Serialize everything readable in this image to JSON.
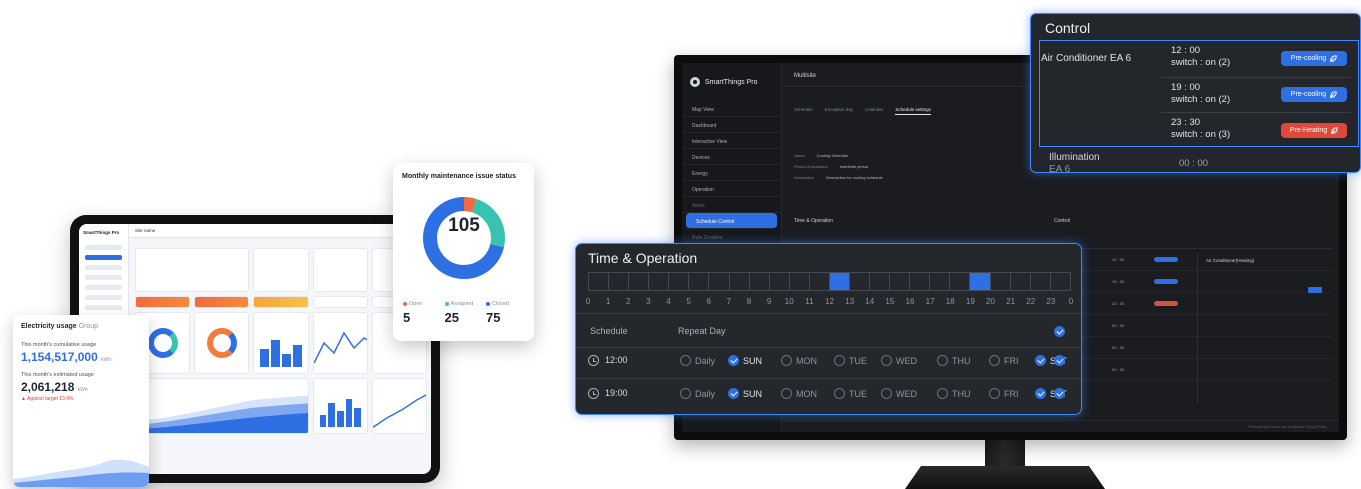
{
  "tablet": {
    "logo": "SmartThings Pro",
    "header": "Site name"
  },
  "maintenance": {
    "title": "Monthly maintenance issue status",
    "total": "105",
    "stats": [
      {
        "label": "Open",
        "value": "5",
        "color": "#f26a3d"
      },
      {
        "label": "Assigned",
        "value": "25",
        "color": "#38c2b1"
      },
      {
        "label": "Closed",
        "value": "75",
        "color": "#2f6fe4"
      }
    ]
  },
  "electricity": {
    "title": "Electricity usage",
    "group": "Group",
    "cumulative_label": "This month's cumulative usage",
    "cumulative_value": "1,154,517,000",
    "cumulative_unit": "kWh",
    "estimated_label": "This month's estimated usage",
    "estimated_value": "2,061,218",
    "estimated_unit": "kWh",
    "target": "▲ Against target 13.4%"
  },
  "monitor": {
    "logo": "SmartThings Pro",
    "topbar": "Multisite",
    "nav": [
      "Map View",
      "Dashboard",
      "Interactive View",
      "Devices",
      "Energy",
      "Operation",
      "Alerts",
      "Schedule Control",
      "Rule Creation"
    ],
    "tabs": [
      "Schedule",
      "Exception day",
      "Calendar",
      "Schedule settings"
    ],
    "form": [
      {
        "k": "Name",
        "v": "Cooling Schedule"
      },
      {
        "k": "Period of operation",
        "v": "Indefinite period"
      },
      {
        "k": "Description",
        "v": "Description for cooling schedule"
      }
    ],
    "section_time": "Time & Operation",
    "section_control": "Control",
    "right_title": "Air Conditioner(Heating)",
    "footer": "Personal Info   Terms and Conditions   Privacy Policy"
  },
  "control": {
    "title": "Control",
    "device": "Air Conditioner EA 6",
    "entries": [
      {
        "time": "12 : 00",
        "switch": "switch : on (2)",
        "action": "Pre-cooling",
        "color": "blue"
      },
      {
        "time": "19 : 00",
        "switch": "switch : on (2)",
        "action": "Pre-cooling",
        "color": "blue"
      },
      {
        "time": "23 : 30",
        "switch": "switch : on (3)",
        "action": "Pre-Heating",
        "color": "red"
      }
    ],
    "illumination": "Illumination",
    "illumination_sub": "EA 6",
    "illumination_time": "00 : 00"
  },
  "time_operation": {
    "title": "Time & Operation",
    "active_slots": [
      12,
      19
    ],
    "hours": [
      "0",
      "1",
      "2",
      "3",
      "4",
      "5",
      "6",
      "7",
      "8",
      "9",
      "10",
      "11",
      "12",
      "13",
      "14",
      "15",
      "16",
      "17",
      "18",
      "19",
      "20",
      "21",
      "22",
      "23",
      "0"
    ],
    "schedule_label": "Schedule",
    "repeat_label": "Repeat Day",
    "days": [
      "Daily",
      "SUN",
      "MON",
      "TUE",
      "WED",
      "THU",
      "FRI",
      "SAT"
    ],
    "rows": [
      {
        "time": "12:00",
        "on": [
          "SUN",
          "SAT"
        ]
      },
      {
        "time": "19:00",
        "on": [
          "SUN",
          "SAT"
        ]
      }
    ]
  }
}
